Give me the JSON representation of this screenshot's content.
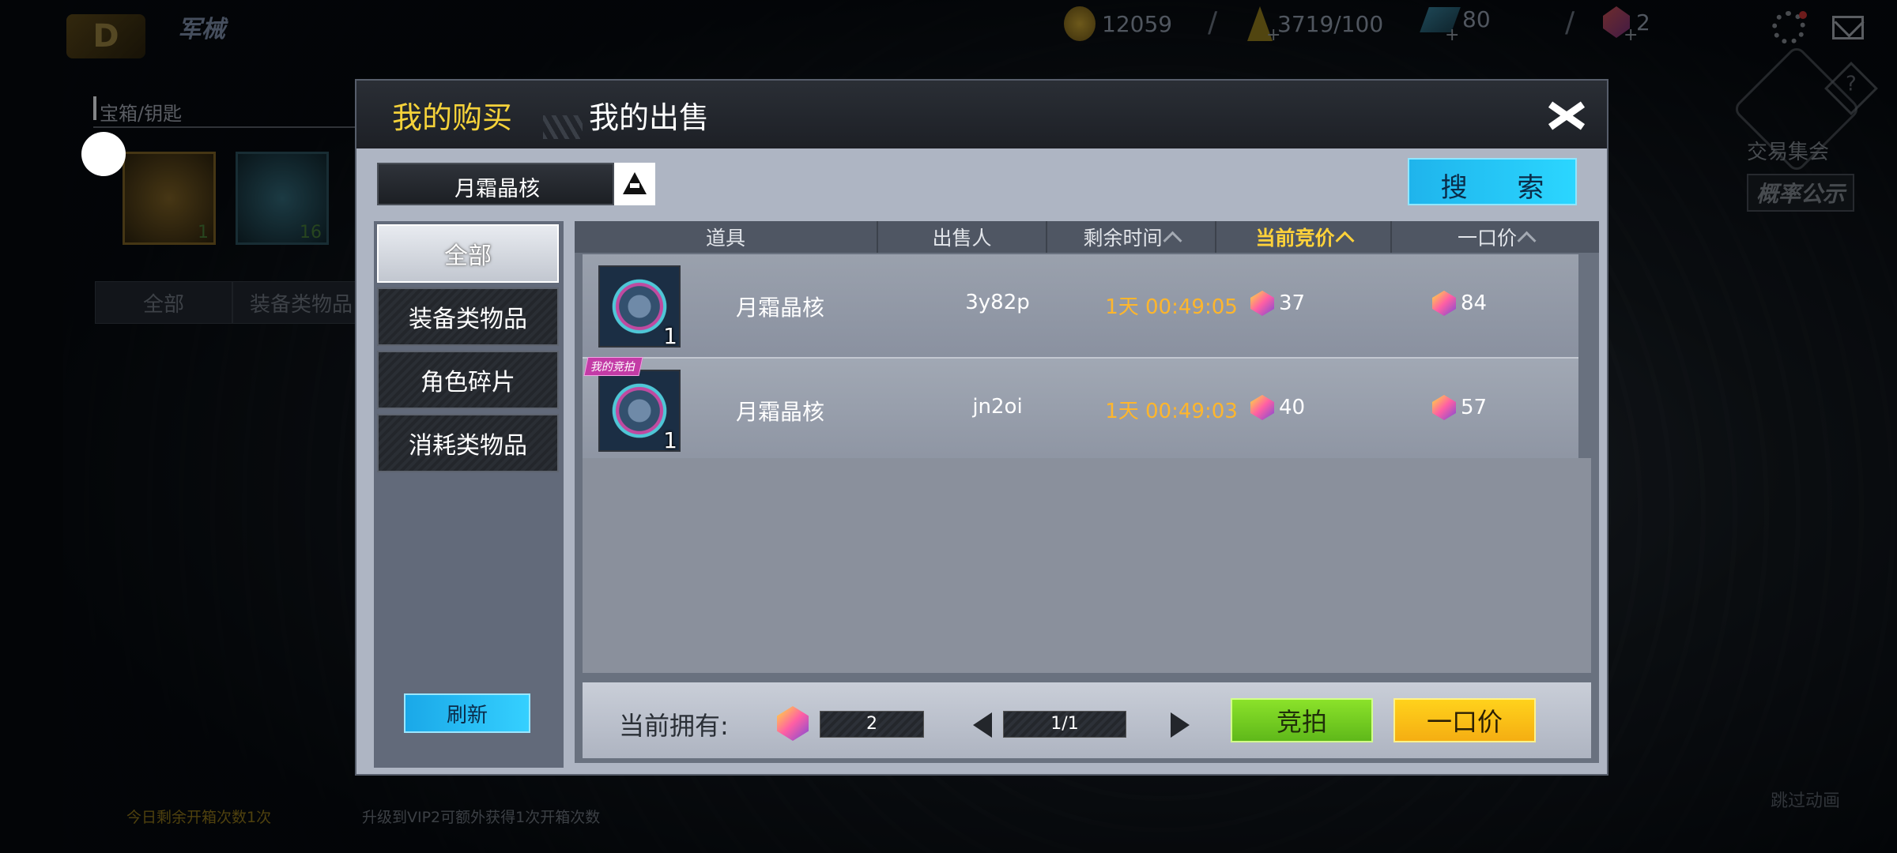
{
  "background": {
    "title": "军械",
    "logo_text": "D",
    "hud": {
      "gold": "12059",
      "energy": "3719/100",
      "diamond": "80",
      "gem": "2",
      "separator": "/",
      "plus": "+"
    },
    "trade_label": "交易集会",
    "prob_label": "概率公示",
    "help": "?",
    "search_text": "宝箱/钥匙",
    "items": [
      {
        "qty": "1"
      },
      {
        "qty": "16"
      }
    ],
    "tabs": [
      "全部",
      "装备类物品"
    ],
    "footer_left": "今日剩余开箱次数1次",
    "footer_mid": "升级到VIP2可额外获得1次开箱次数",
    "skip": "跳过动画"
  },
  "dialog": {
    "tabs": {
      "buy": "我的购买",
      "sell": "我的出售"
    },
    "search": {
      "value": "月霜晶核",
      "button": "搜  索"
    },
    "categories": [
      "全部",
      "装备类物品",
      "角色碎片",
      "消耗类物品"
    ],
    "refresh": "刷新",
    "columns": [
      "道具",
      "出售人",
      "剩余时间",
      "当前竞价",
      "一口价"
    ],
    "rows": [
      {
        "name": "月霜晶核",
        "qty": "1",
        "seller": "3y82p",
        "time": "1天  00:49:05",
        "bid": "37",
        "buyout": "84",
        "badge": ""
      },
      {
        "name": "月霜晶核",
        "qty": "1",
        "seller": "jn2oi",
        "time": "1天  00:49:03",
        "bid": "40",
        "buyout": "57",
        "badge": "我的竞拍"
      }
    ],
    "footer": {
      "own_label": "当前拥有:",
      "own_value": "2",
      "page": "1/1",
      "bid_button": "竞拍",
      "buyout_button": "一口价"
    }
  },
  "colors": {
    "accent_yellow": "#f5d23a",
    "time_orange": "#ffb62c",
    "search_blue": "#1fb4ec",
    "bid_green": "#6cc81e",
    "buy_yellow": "#ffd21c"
  }
}
